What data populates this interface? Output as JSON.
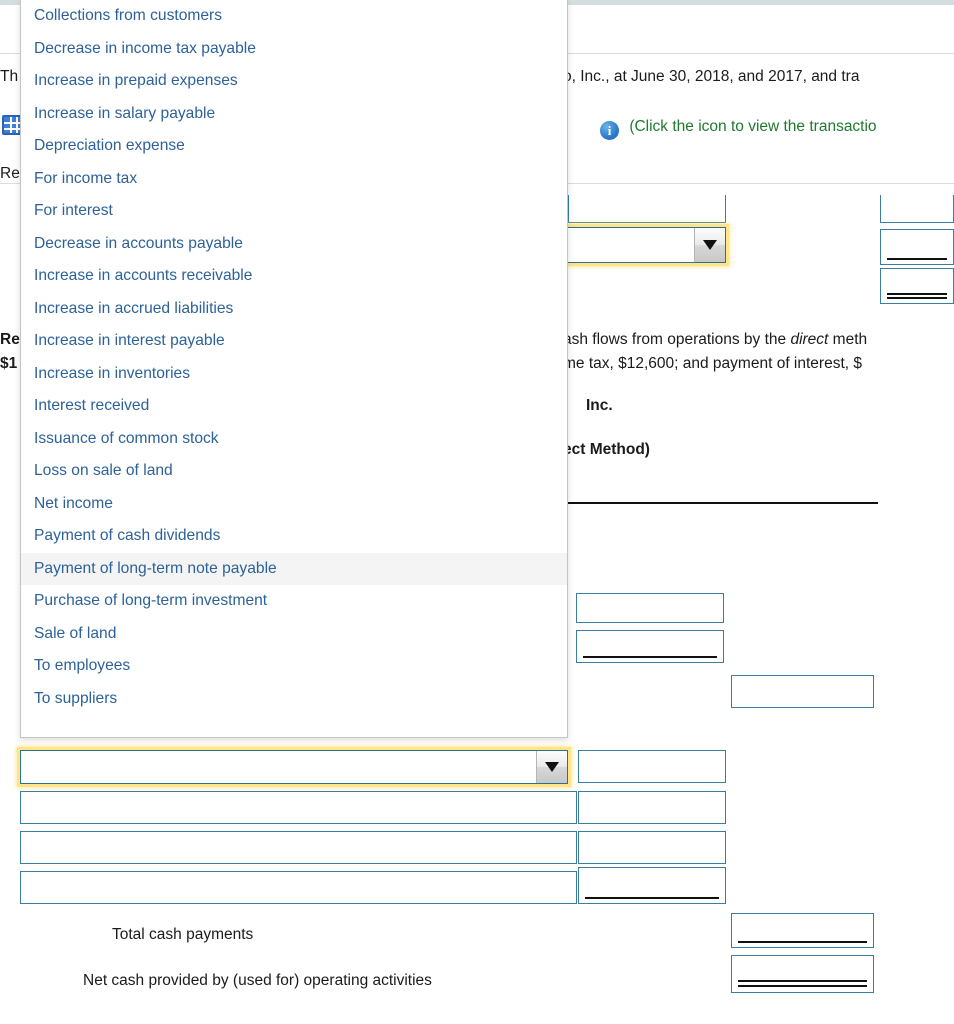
{
  "window": {
    "top_bar_color": "#d5dde1"
  },
  "problem": {
    "intro_left_visible": "Th",
    "intro_right_visible": "o, Inc., at June 30, 2018, and 2017, and tra",
    "click_icon_text": "(Click the icon to view the transactio",
    "requirement_label_visible": "Re",
    "requirement2_label_visible": "Re",
    "requirement2_amount_visible": "$1",
    "requirement2_right_line1": "ash flows from operations by the ",
    "requirement2_right_line1_italic": "direct",
    "requirement2_right_line1_tail": " meth",
    "requirement2_right_line2": "me tax, $12,600; and payment of interest, $"
  },
  "statement": {
    "company_visible": "Inc.",
    "method_visible": "ect Method)",
    "period_visible": ";"
  },
  "icons": {
    "spreadsheet": "spreadsheet-icon",
    "info": "info-icon",
    "dropdown_arrow": "chevron-down-icon"
  },
  "fields": {
    "select_top_value": "",
    "select_bottom_value": "",
    "amount_boxes": [
      "",
      "",
      "",
      "",
      "",
      "",
      "",
      "",
      "",
      "",
      ""
    ]
  },
  "labels": {
    "total_cash_payments": "Total cash payments",
    "net_cash": "Net cash provided by (used for) operating activities"
  },
  "dropdown": {
    "selected": "Payment of long-term note payable",
    "options": [
      "Collections from customers",
      "Decrease in income tax payable",
      "Increase in prepaid expenses",
      "Increase in salary payable",
      "Depreciation expense",
      "For income tax",
      "For interest",
      "Decrease in accounts payable",
      "Increase in accounts receivable",
      "Increase in accrued liabilities",
      "Increase in interest payable",
      "Increase in inventories",
      "Interest received",
      "Issuance of common stock",
      "Loss on sale of land",
      "Net income",
      "Payment of cash dividends",
      "Payment of long-term note payable",
      "Purchase of long-term investment",
      "Sale of land",
      "To employees",
      "To suppliers"
    ]
  },
  "colors": {
    "link_blue": "#2d6199",
    "field_border": "#3a7d9e",
    "focus_yellow": "#ffd64d",
    "green_text": "#1f7a2e"
  }
}
